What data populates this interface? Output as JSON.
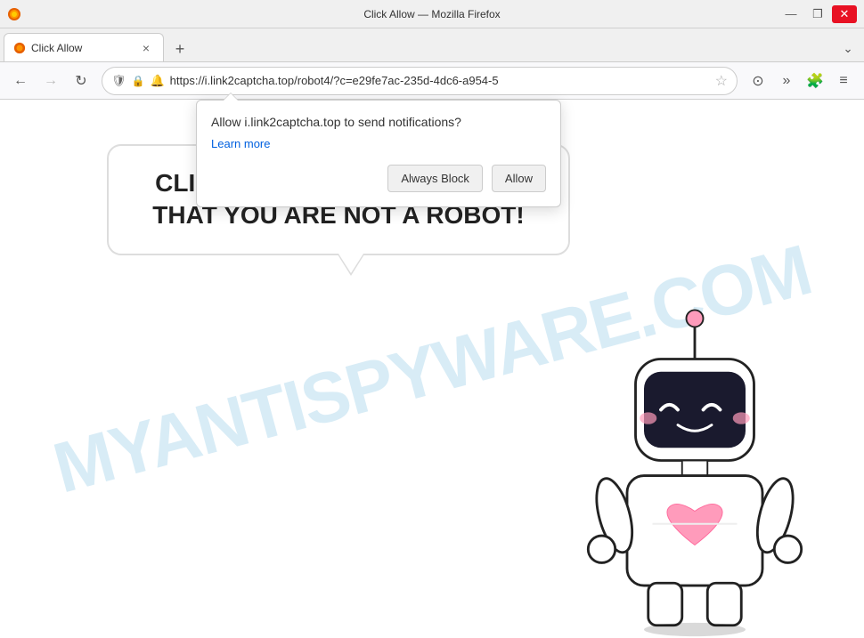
{
  "titleBar": {
    "title": "Click Allow — Mozilla Firefox",
    "minLabel": "—",
    "maxLabel": "❐",
    "closeLabel": "✕"
  },
  "tab": {
    "title": "Click Allow",
    "closeLabel": "×",
    "newTabLabel": "+",
    "listAllLabel": "⌄"
  },
  "navBar": {
    "backLabel": "←",
    "forwardLabel": "→",
    "reloadLabel": "↻",
    "url": "https://i.link2captcha.top/robot4/?c=e29fe7ac-235d-4dc6-a954-5",
    "starLabel": "☆",
    "pocketLabel": "⊙",
    "moreLabel": "»",
    "extensionsLabel": "🧩",
    "menuLabel": "≡"
  },
  "notificationPopup": {
    "title": "Allow i.link2captcha.top to send notifications?",
    "learnMoreLabel": "Learn more",
    "alwaysBlockLabel": "Always Block",
    "allowLabel": "Allow"
  },
  "pageContent": {
    "watermark": "MYANTISPYWARE.COM",
    "speechBubble": "CLICK «ALLOW» TO CONFIRM THAT YOU ARE NOT A ROBOT!"
  }
}
